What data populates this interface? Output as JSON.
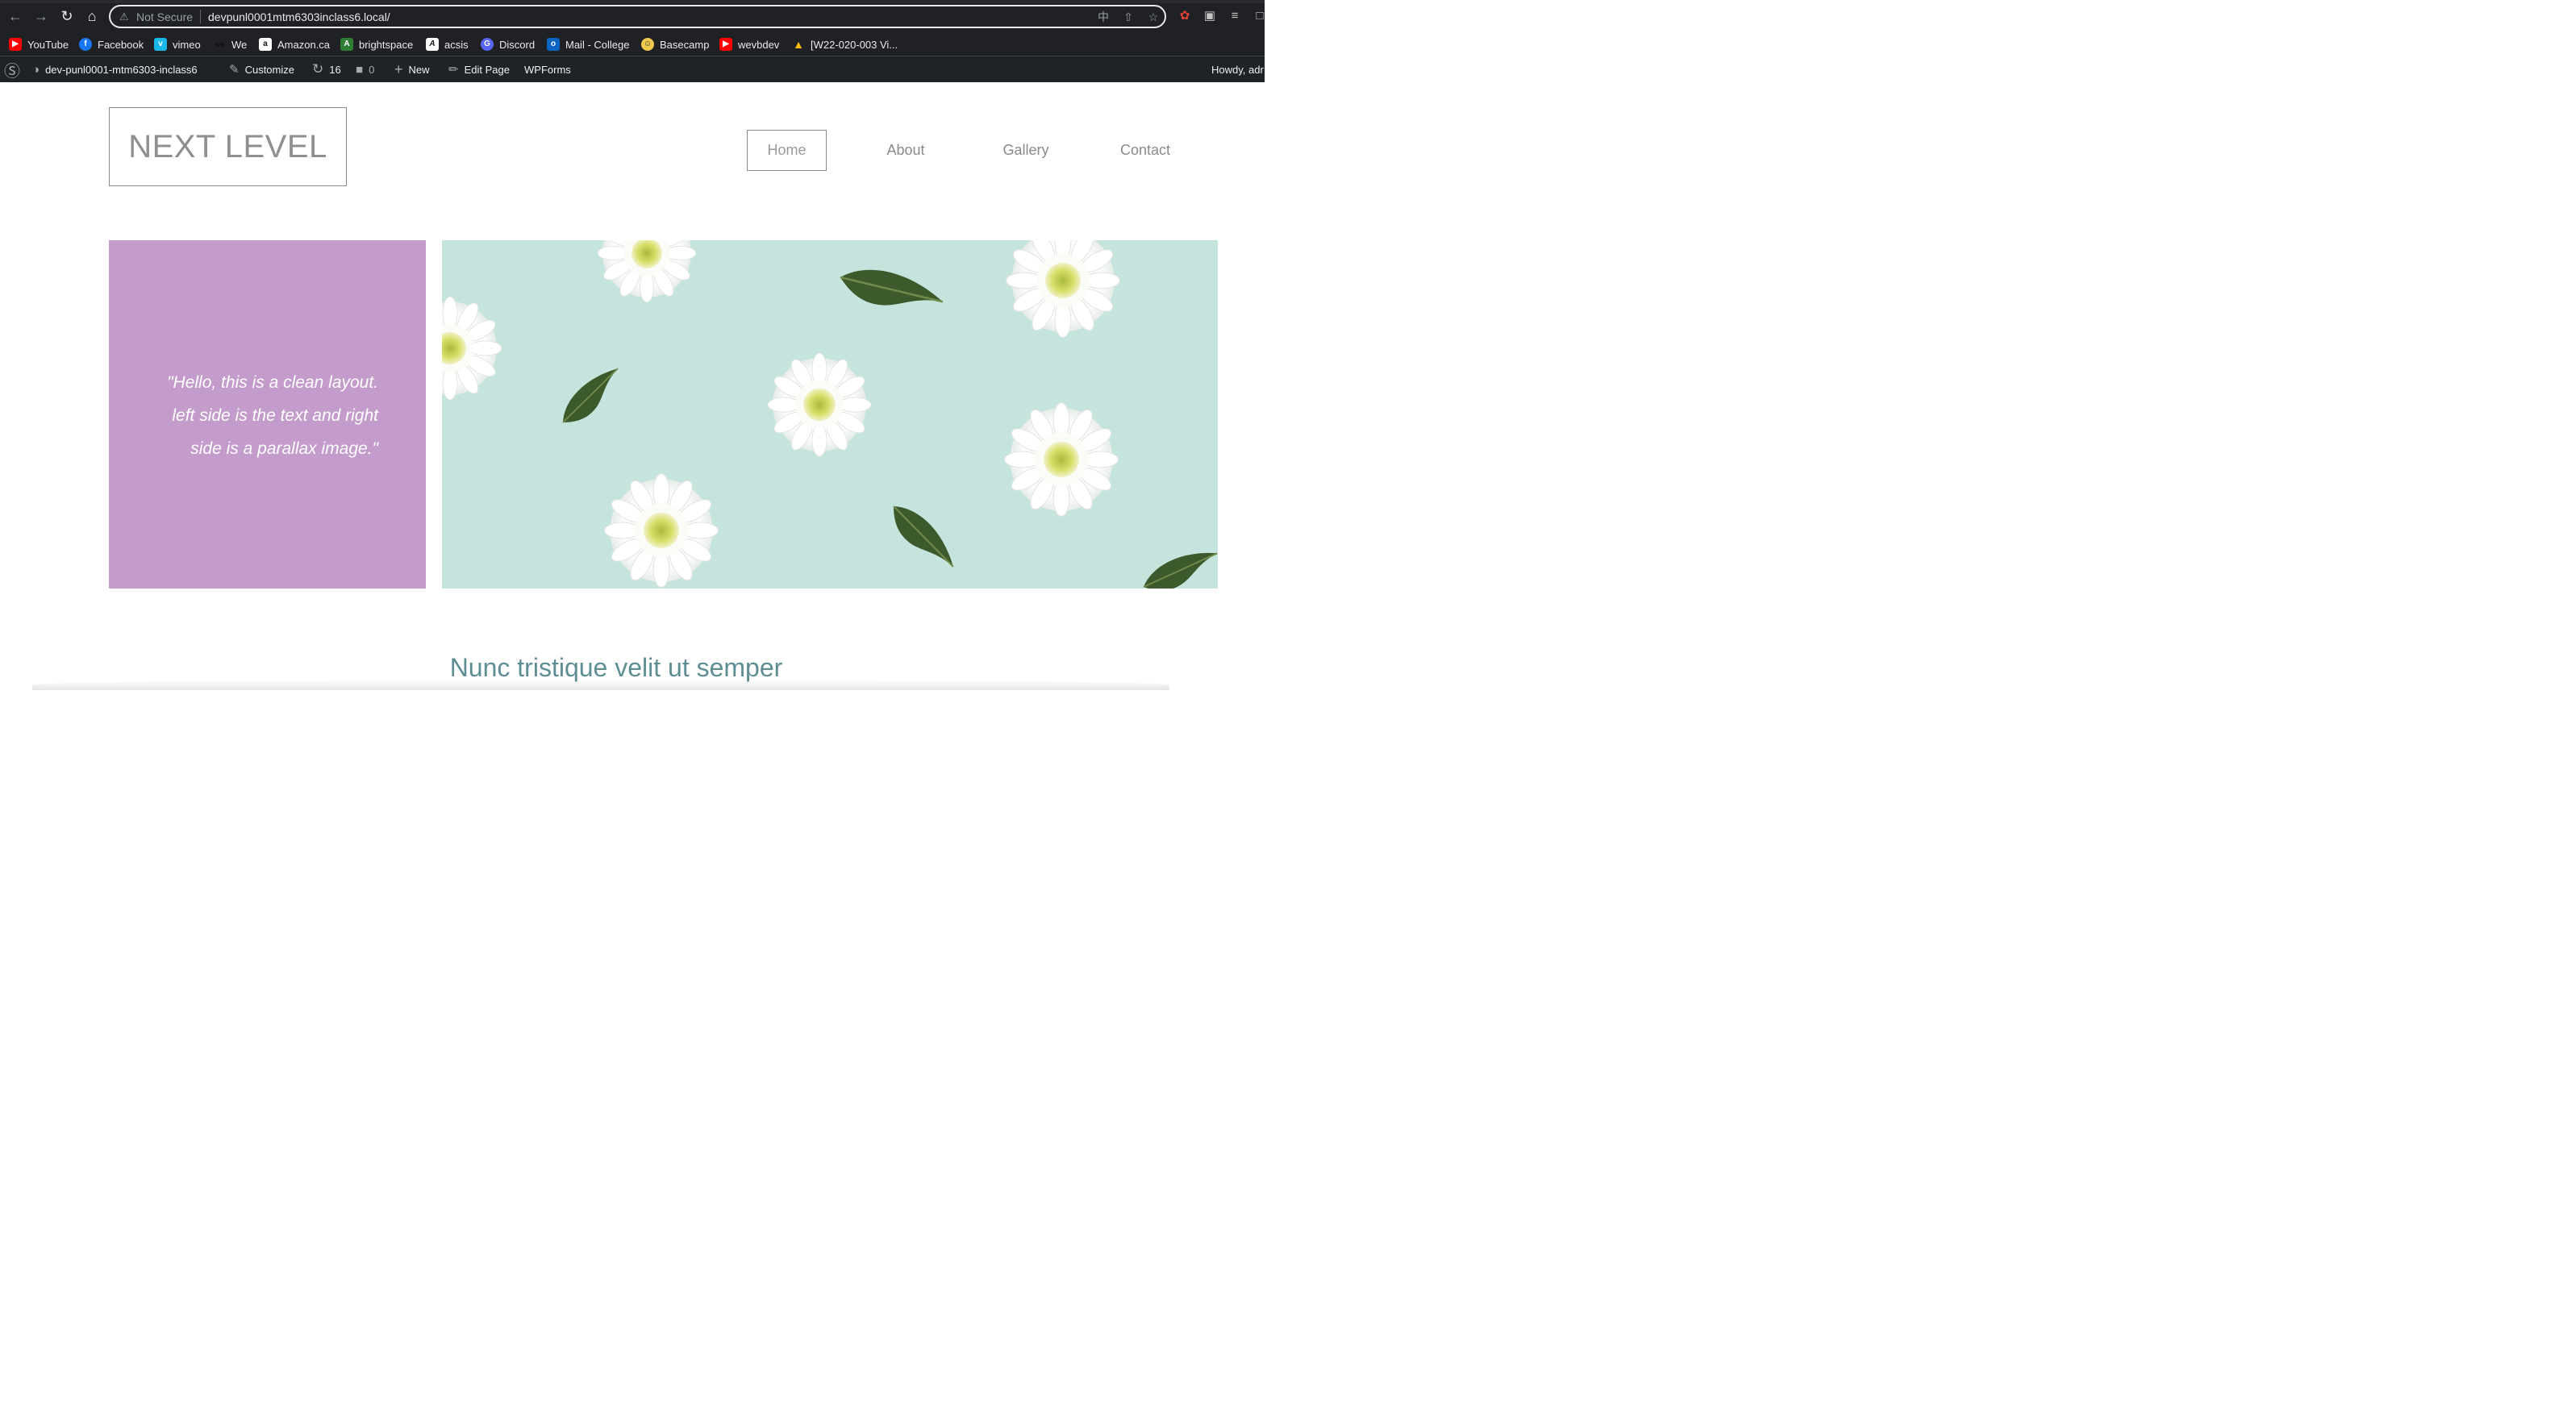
{
  "browser": {
    "security_label": "Not Secure",
    "url": "devpunl0001mtm6303inclass6.local/"
  },
  "bookmarks": [
    {
      "label": "YouTube",
      "icon": "youtube-icon",
      "color": "#ff0000"
    },
    {
      "label": "Facebook",
      "icon": "facebook-icon",
      "color": "#1877f2"
    },
    {
      "label": "vimeo",
      "icon": "vimeo-icon",
      "color": "#1ab7ea"
    },
    {
      "label": "We",
      "icon": "we-icon",
      "color": "#111111"
    },
    {
      "label": "Amazon.ca",
      "icon": "amazon-icon",
      "color": "#ffffff"
    },
    {
      "label": "brightspace",
      "icon": "brightspace-icon",
      "color": "#2e7d32"
    },
    {
      "label": "acsis",
      "icon": "acsis-icon",
      "color": "#ffffff"
    },
    {
      "label": "Discord",
      "icon": "discord-icon",
      "color": "#5865f2"
    },
    {
      "label": "Mail - College",
      "icon": "outlook-icon",
      "color": "#0a64c2"
    },
    {
      "label": "Basecamp",
      "icon": "basecamp-icon",
      "color": "#f2c94c"
    },
    {
      "label": "wevbdev",
      "icon": "youtube-icon",
      "color": "#ff0000"
    },
    {
      "label": "[W22-020-003 Vi...",
      "icon": "drive-icon",
      "color": "#34a853"
    }
  ],
  "adminbar": {
    "site_name": "dev-punl0001-mtm6303-inclass6",
    "customize": "Customize",
    "updates_count": "16",
    "comments_count": "0",
    "new": "New",
    "edit_page": "Edit Page",
    "wpforms": "WPForms",
    "howdy": "Howdy, adr"
  },
  "site": {
    "logo": "NEXT LEVEL",
    "nav": [
      "Home",
      "About",
      "Gallery",
      "Contact"
    ],
    "active_nav": "Home",
    "quote_lines": [
      "\"Hello, this is a clean layout.",
      "left side is the text and right",
      "side is a parallax image.\""
    ],
    "section_heading": "Nunc tristique velit ut semper"
  },
  "colors": {
    "quote_bg": "#c39ccb",
    "hero_bg": "#c6e4de",
    "heading": "#5e8e93"
  }
}
